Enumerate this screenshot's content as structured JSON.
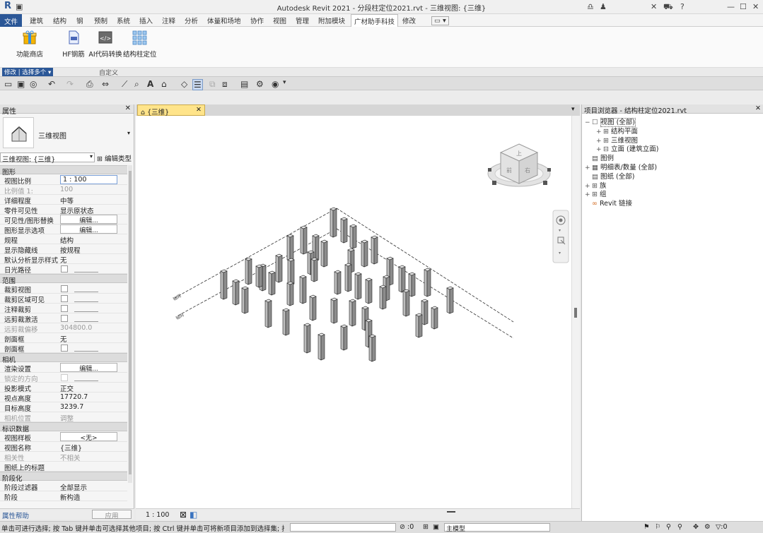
{
  "window": {
    "title": "Autodesk Revit 2021 - 分段柱定位2021.rvt - 三维视图: {三维}",
    "logo": "R"
  },
  "ribbon": {
    "tabs": [
      "文件",
      "建筑",
      "结构",
      "钢",
      "预制",
      "系统",
      "插入",
      "注释",
      "分析",
      "体量和场地",
      "协作",
      "视图",
      "管理",
      "附加模块",
      "广材助手科技",
      "修改"
    ],
    "active_tab": "广材助手科技",
    "buttons": [
      {
        "label": "功能商店",
        "icon": "gift-icon"
      },
      {
        "label": "HF钢筋",
        "icon": "document-icon"
      },
      {
        "label": "AI代码转换",
        "icon": "code-icon"
      },
      {
        "label": "结构柱定位",
        "icon": "grid-icon"
      }
    ],
    "panel_label": "自定义",
    "select_label": "修改 | 选择多个"
  },
  "properties": {
    "title": "属性",
    "type_name": "三维视图",
    "selector": "三维视图: {三维}",
    "edit_type": "编辑类型",
    "groups": [
      {
        "name": "图形",
        "rows": [
          {
            "k": "视图比例",
            "v": "1 : 100",
            "kind": "input"
          },
          {
            "k": "比例值 1:",
            "v": "100",
            "kind": "dim"
          },
          {
            "k": "详细程度",
            "v": "中等"
          },
          {
            "k": "零件可见性",
            "v": "显示原状态"
          },
          {
            "k": "可见性/图形替换",
            "v": "编辑...",
            "kind": "button"
          },
          {
            "k": "图形显示选项",
            "v": "编辑...",
            "kind": "button"
          },
          {
            "k": "规程",
            "v": "结构"
          },
          {
            "k": "显示隐藏线",
            "v": "按规程"
          },
          {
            "k": "默认分析显示样式",
            "v": "无"
          },
          {
            "k": "日光路径",
            "v": "",
            "kind": "check"
          }
        ]
      },
      {
        "name": "范围",
        "rows": [
          {
            "k": "裁剪视图",
            "v": "",
            "kind": "check"
          },
          {
            "k": "裁剪区域可见",
            "v": "",
            "kind": "check"
          },
          {
            "k": "注释裁剪",
            "v": "",
            "kind": "check"
          },
          {
            "k": "远剪裁激活",
            "v": "",
            "kind": "check"
          },
          {
            "k": "远剪裁偏移",
            "v": "304800.0",
            "kind": "dim"
          },
          {
            "k": "剖面框",
            "v": "无"
          },
          {
            "k": "剖面框",
            "v": "",
            "kind": "check"
          }
        ]
      },
      {
        "name": "相机",
        "rows": [
          {
            "k": "渲染设置",
            "v": "编辑...",
            "kind": "button"
          },
          {
            "k": "锁定的方向",
            "v": "",
            "kind": "dimcheck"
          },
          {
            "k": "投影模式",
            "v": "正交"
          },
          {
            "k": "视点高度",
            "v": "17720.7"
          },
          {
            "k": "目标高度",
            "v": "3239.7"
          },
          {
            "k": "相机位置",
            "v": "调整",
            "kind": "dim"
          }
        ]
      },
      {
        "name": "标识数据",
        "rows": [
          {
            "k": "视图样板",
            "v": "<无>",
            "kind": "button"
          },
          {
            "k": "视图名称",
            "v": "{三维}"
          },
          {
            "k": "相关性",
            "v": "不相关",
            "kind": "dim"
          },
          {
            "k": "图纸上的标题",
            "v": ""
          }
        ]
      },
      {
        "name": "阶段化",
        "rows": [
          {
            "k": "阶段过滤器",
            "v": "全部显示"
          },
          {
            "k": "阶段",
            "v": "新构造"
          }
        ]
      }
    ],
    "help_link": "属性帮助",
    "apply": "应用"
  },
  "view": {
    "tab_label": "{三维}",
    "scale": "1 : 100",
    "viewcube": {
      "top": "上",
      "front": "前",
      "right": "右"
    },
    "grid_labels": [
      "轴网",
      "轴网"
    ]
  },
  "project_browser": {
    "title": "项目浏览器 - 结构柱定位2021.rvt",
    "nodes": [
      {
        "label": "视图 (全部)",
        "level": 0,
        "sign": "−"
      },
      {
        "label": "结构平面",
        "level": 1,
        "sign": "+"
      },
      {
        "label": "三维视图",
        "level": 1,
        "sign": "+"
      },
      {
        "label": "立面 (建筑立面)",
        "level": 1,
        "sign": "+"
      },
      {
        "label": "图例",
        "level": 0,
        "sign": ""
      },
      {
        "label": "明细表/数量 (全部)",
        "level": 0,
        "sign": "+"
      },
      {
        "label": "图纸 (全部)",
        "level": 0,
        "sign": ""
      },
      {
        "label": "族",
        "level": 0,
        "sign": "+"
      },
      {
        "label": "组",
        "level": 0,
        "sign": "+"
      },
      {
        "label": "Revit 链接",
        "level": 0,
        "sign": ""
      }
    ]
  },
  "status": {
    "message": "单击可进行选择; 按 Tab 键并单击可选择其他项目; 按 Ctrl 键并单击可将新项目添加到选择集; 按 Sh",
    "count": ":0",
    "model": "主模型",
    "filter": "▽:0"
  },
  "colors": {
    "file_tab": "#2b5797",
    "view_tab": "#ffe48a",
    "viewport_bg": "#ffffff"
  }
}
